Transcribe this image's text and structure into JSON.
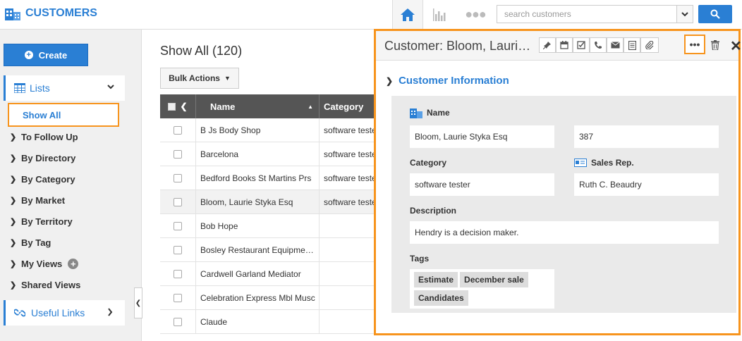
{
  "app": {
    "title": "CUSTOMERS"
  },
  "search": {
    "placeholder": "search customers"
  },
  "sidebar": {
    "create_label": "Create",
    "lists_label": "Lists",
    "show_all": "Show All",
    "items": [
      {
        "label": "To Follow Up"
      },
      {
        "label": "By Directory"
      },
      {
        "label": "By Category"
      },
      {
        "label": "By Market"
      },
      {
        "label": "By Territory"
      },
      {
        "label": "By Tag"
      },
      {
        "label": "My Views"
      },
      {
        "label": "Shared Views"
      }
    ],
    "useful_links": "Useful Links"
  },
  "main": {
    "title": "Show All (120)",
    "bulk_actions": "Bulk Actions",
    "columns": {
      "name": "Name",
      "category": "Category"
    },
    "rows": [
      {
        "name": "B Js Body Shop",
        "category": "software tester"
      },
      {
        "name": "Barcelona",
        "category": "software tester"
      },
      {
        "name": "Bedford Books St Martins Prs",
        "category": "software tester"
      },
      {
        "name": "Bloom, Laurie Styka Esq",
        "category": "software tester"
      },
      {
        "name": "Bob Hope",
        "category": ""
      },
      {
        "name": "Bosley Restaurant Equipme…",
        "category": ""
      },
      {
        "name": "Cardwell Garland Mediator",
        "category": ""
      },
      {
        "name": "Celebration Express Mbl Musc",
        "category": ""
      },
      {
        "name": "Claude",
        "category": ""
      }
    ]
  },
  "panel": {
    "title": "Customer: Bloom, Lauri…",
    "section": "Customer Information",
    "name_label": "Name",
    "name_value": "Bloom, Laurie Styka Esq",
    "number_value": "387",
    "category_label": "Category",
    "category_value": "software tester",
    "salesrep_label": "Sales Rep.",
    "salesrep_value": "Ruth C. Beaudry",
    "description_label": "Description",
    "description_value": "Hendry is a decision maker.",
    "tags_label": "Tags",
    "tags": [
      "Estimate",
      "December sale",
      "Candidates"
    ],
    "more_label": "•••"
  },
  "colors": {
    "accent": "#2a7fd4",
    "highlight": "#f7941d"
  }
}
